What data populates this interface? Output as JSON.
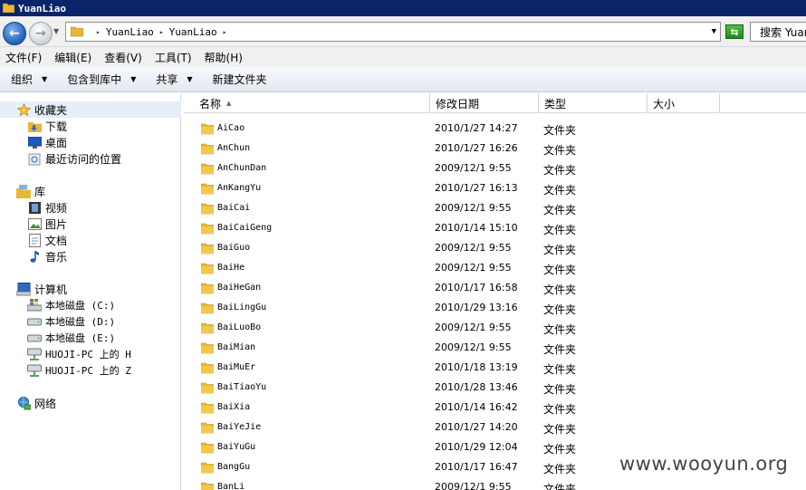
{
  "window": {
    "title": "YuanLiao"
  },
  "address": {
    "segments": [
      "YuanLiao",
      "YuanLiao"
    ]
  },
  "search": {
    "placeholder": "搜索 YuanLiao"
  },
  "menu": [
    "文件(F)",
    "编辑(E)",
    "查看(V)",
    "工具(T)",
    "帮助(H)"
  ],
  "commands": {
    "organize": "组织",
    "include_in_library": "包含到库中",
    "share": "共享",
    "new_folder": "新建文件夹"
  },
  "nav": {
    "favorites": {
      "label": "收藏夹",
      "items": [
        "下载",
        "桌面",
        "最近访问的位置"
      ]
    },
    "libraries": {
      "label": "库",
      "items": [
        "视频",
        "图片",
        "文档",
        "音乐"
      ]
    },
    "computer": {
      "label": "计算机",
      "items": [
        "本地磁盘 (C:)",
        "本地磁盘 (D:)",
        "本地磁盘 (E:)",
        "HUOJI-PC 上的 H",
        "HUOJI-PC 上的 Z"
      ]
    },
    "network": {
      "label": "网络"
    }
  },
  "columns": {
    "name": "名称",
    "date": "修改日期",
    "type": "类型",
    "size": "大小"
  },
  "files": [
    {
      "name": "AiCao",
      "date": "2010/1/27 14:27",
      "type": "文件夹"
    },
    {
      "name": "AnChun",
      "date": "2010/1/27 16:26",
      "type": "文件夹"
    },
    {
      "name": "AnChunDan",
      "date": "2009/12/1 9:55",
      "type": "文件夹"
    },
    {
      "name": "AnKangYu",
      "date": "2010/1/27 16:13",
      "type": "文件夹"
    },
    {
      "name": "BaiCai",
      "date": "2009/12/1 9:55",
      "type": "文件夹"
    },
    {
      "name": "BaiCaiGeng",
      "date": "2010/1/14 15:10",
      "type": "文件夹"
    },
    {
      "name": "BaiGuo",
      "date": "2009/12/1 9:55",
      "type": "文件夹"
    },
    {
      "name": "BaiHe",
      "date": "2009/12/1 9:55",
      "type": "文件夹"
    },
    {
      "name": "BaiHeGan",
      "date": "2010/1/17 16:58",
      "type": "文件夹"
    },
    {
      "name": "BaiLingGu",
      "date": "2010/1/29 13:16",
      "type": "文件夹"
    },
    {
      "name": "BaiLuoBo",
      "date": "2009/12/1 9:55",
      "type": "文件夹"
    },
    {
      "name": "BaiMian",
      "date": "2009/12/1 9:55",
      "type": "文件夹"
    },
    {
      "name": "BaiMuEr",
      "date": "2010/1/18 13:19",
      "type": "文件夹"
    },
    {
      "name": "BaiTiaoYu",
      "date": "2010/1/28 13:46",
      "type": "文件夹"
    },
    {
      "name": "BaiXia",
      "date": "2010/1/14 16:42",
      "type": "文件夹"
    },
    {
      "name": "BaiYeJie",
      "date": "2010/1/27 14:20",
      "type": "文件夹"
    },
    {
      "name": "BaiYuGu",
      "date": "2010/1/29 12:04",
      "type": "文件夹"
    },
    {
      "name": "BangGu",
      "date": "2010/1/17 16:47",
      "type": "文件夹"
    },
    {
      "name": "BanLi",
      "date": "2009/12/1 9:55",
      "type": "文件夹"
    }
  ],
  "watermark": "www.wooyun.org",
  "colors": {
    "titlebar": "#0a246a",
    "folder": "#e8b733",
    "selection": "#e5eef9"
  }
}
